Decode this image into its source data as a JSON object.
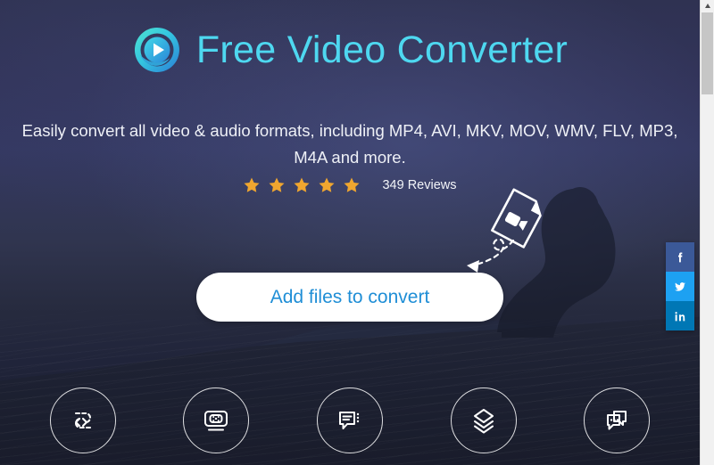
{
  "colors": {
    "bg_top": "#2f3252",
    "bg_bottom": "#191d2c",
    "title_cyan": "#4ed8f0",
    "cta_bg": "#ffffff",
    "cta_text": "#1f8ed6",
    "star": "#f0a62f",
    "facebook": "#3b5998",
    "twitter": "#1da1f2",
    "linkedin": "#0077b5",
    "scrollbar_track": "#f1f1f1",
    "scrollbar_thumb": "#c6c6c6"
  },
  "header": {
    "logo_icon": "play-circle-logo-icon",
    "title": "Free Video Converter"
  },
  "hero": {
    "tagline": "Easily convert all video & audio formats, including MP4, AVI, MKV, MOV, WMV, FLV, MP3, M4A and more.",
    "rating": {
      "stars_total": 5,
      "stars_filled": 5,
      "star_icon": "star-icon",
      "reviews_label": "349 Reviews"
    },
    "cta": {
      "label": "Add files to convert"
    },
    "drop_hint": {
      "file_icon": "video-file-icon",
      "arrow_icon": "dashed-curved-arrow-icon"
    },
    "background": {
      "scene_icon": "night-desert-dunes-background",
      "figure_icon": "kneeling-person-silhouette-icon"
    }
  },
  "features": [
    {
      "icon": "convert-arrows-icon",
      "name": "feature-convert"
    },
    {
      "icon": "screen-recorder-icon",
      "name": "feature-screen-recorder"
    },
    {
      "icon": "subtitle-bubble-icon",
      "name": "feature-subtitles"
    },
    {
      "icon": "layers-stack-icon",
      "name": "feature-merge"
    },
    {
      "icon": "chat-bubbles-icon",
      "name": "feature-support"
    }
  ],
  "social": [
    {
      "network": "facebook",
      "icon": "facebook-icon",
      "color": "#3b5998"
    },
    {
      "network": "twitter",
      "icon": "twitter-icon",
      "color": "#1da1f2"
    },
    {
      "network": "linkedin",
      "icon": "linkedin-icon",
      "color": "#0077b5"
    }
  ],
  "scrollbar": {
    "up_arrow_icon": "scroll-up-arrow-icon",
    "down_arrow_icon": "scroll-down-arrow-icon",
    "thumb_icon": "scrollbar-thumb"
  }
}
